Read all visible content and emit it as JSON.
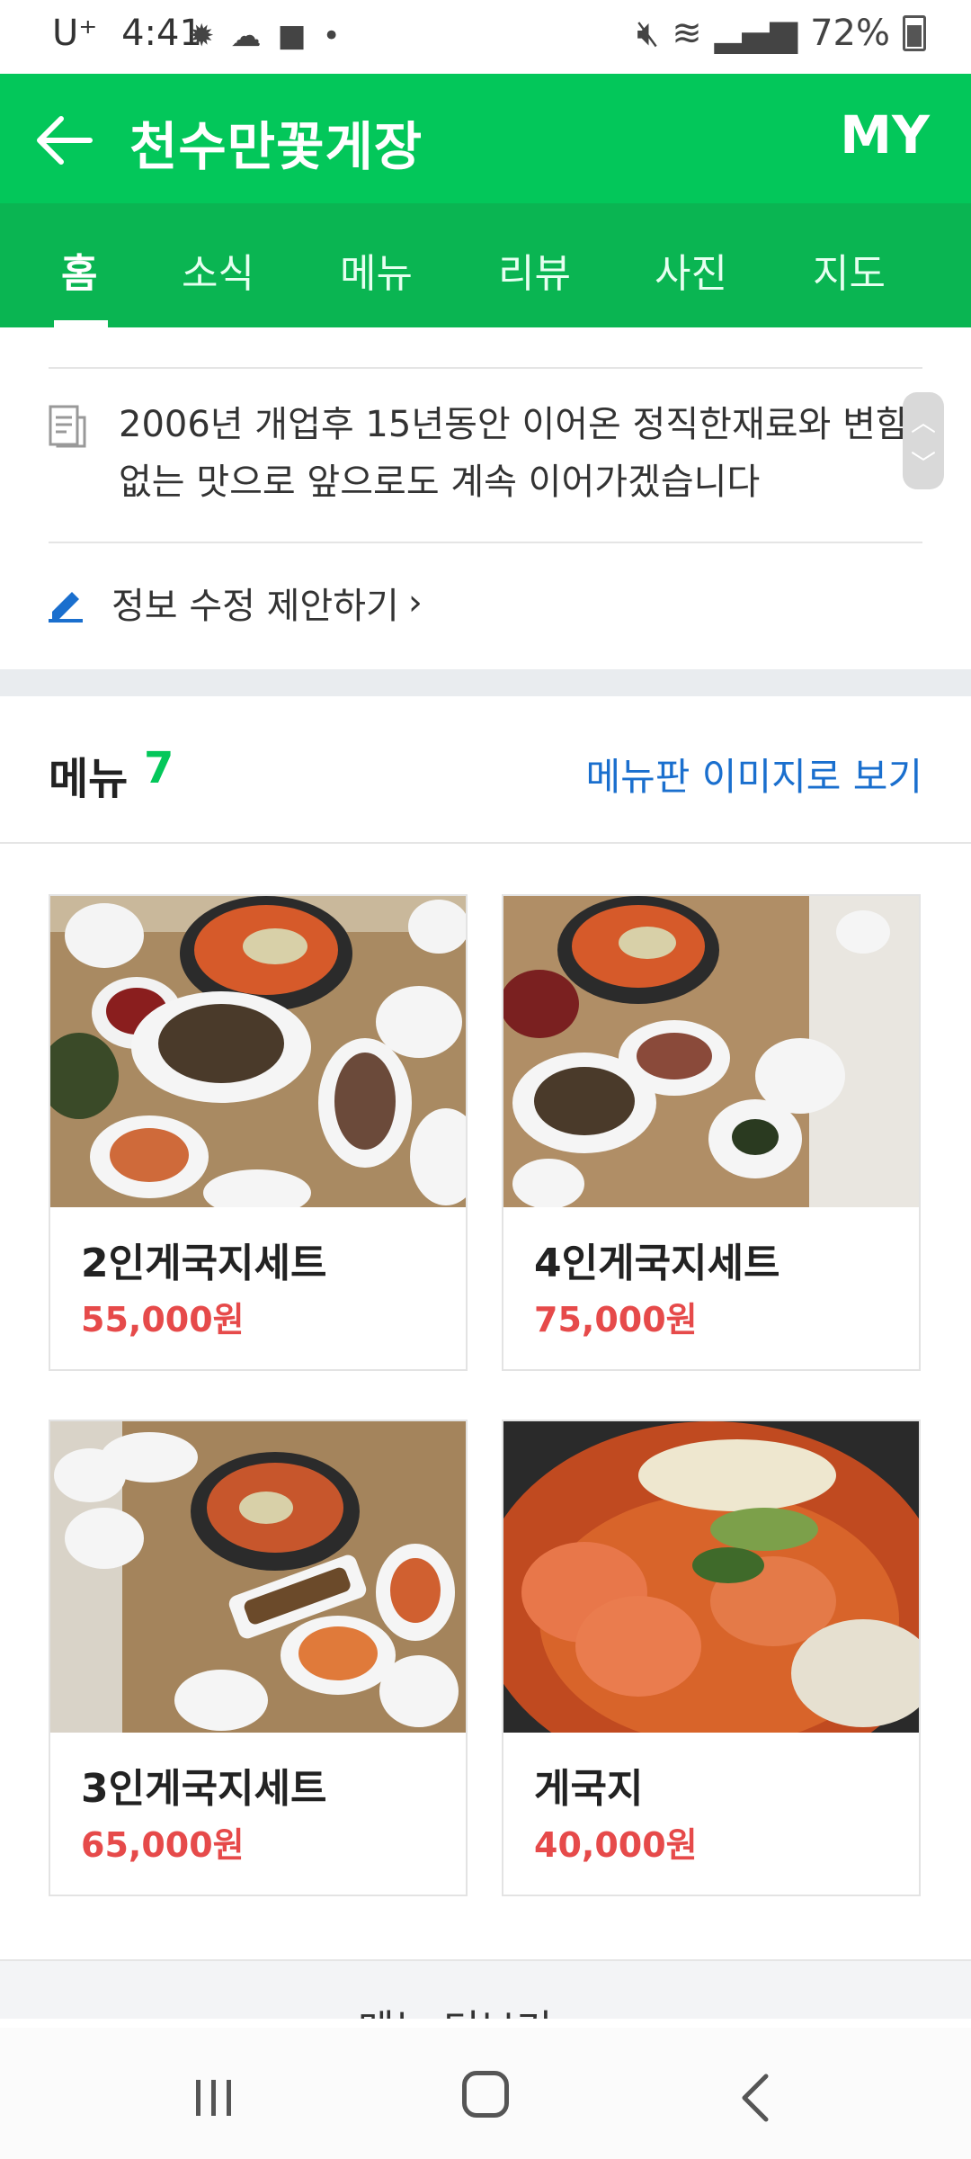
{
  "status_bar": {
    "carrier": "U⁺",
    "time": "4:41",
    "battery": "72%"
  },
  "header": {
    "title": "천수만꽃게장",
    "my_label": "MY"
  },
  "tabs": [
    {
      "label": "홈"
    },
    {
      "label": "소식"
    },
    {
      "label": "메뉴"
    },
    {
      "label": "리뷰"
    },
    {
      "label": "사진"
    },
    {
      "label": "지도"
    }
  ],
  "info": {
    "description": "2006년 개업후 15년동안 이어온 정직한재료와 변함없는 맛으로 앞으로도 계속 이어가겠습니다",
    "edit_suggestion": "정보 수정 제안하기"
  },
  "menu_section": {
    "title": "메뉴",
    "count": "7",
    "image_link": "메뉴판 이미지로 보기",
    "items": [
      {
        "name": "2인게국지세트",
        "price": "55,000원"
      },
      {
        "name": "4인게국지세트",
        "price": "75,000원"
      },
      {
        "name": "3인게국지세트",
        "price": "65,000원"
      },
      {
        "name": "게국지",
        "price": "40,000원"
      }
    ],
    "more_label": "메뉴 더보기"
  },
  "colors": {
    "brand_green": "#03c75a",
    "tab_green": "#0ab552",
    "price_red": "#e64a4a",
    "link_blue": "#1a6fce"
  }
}
